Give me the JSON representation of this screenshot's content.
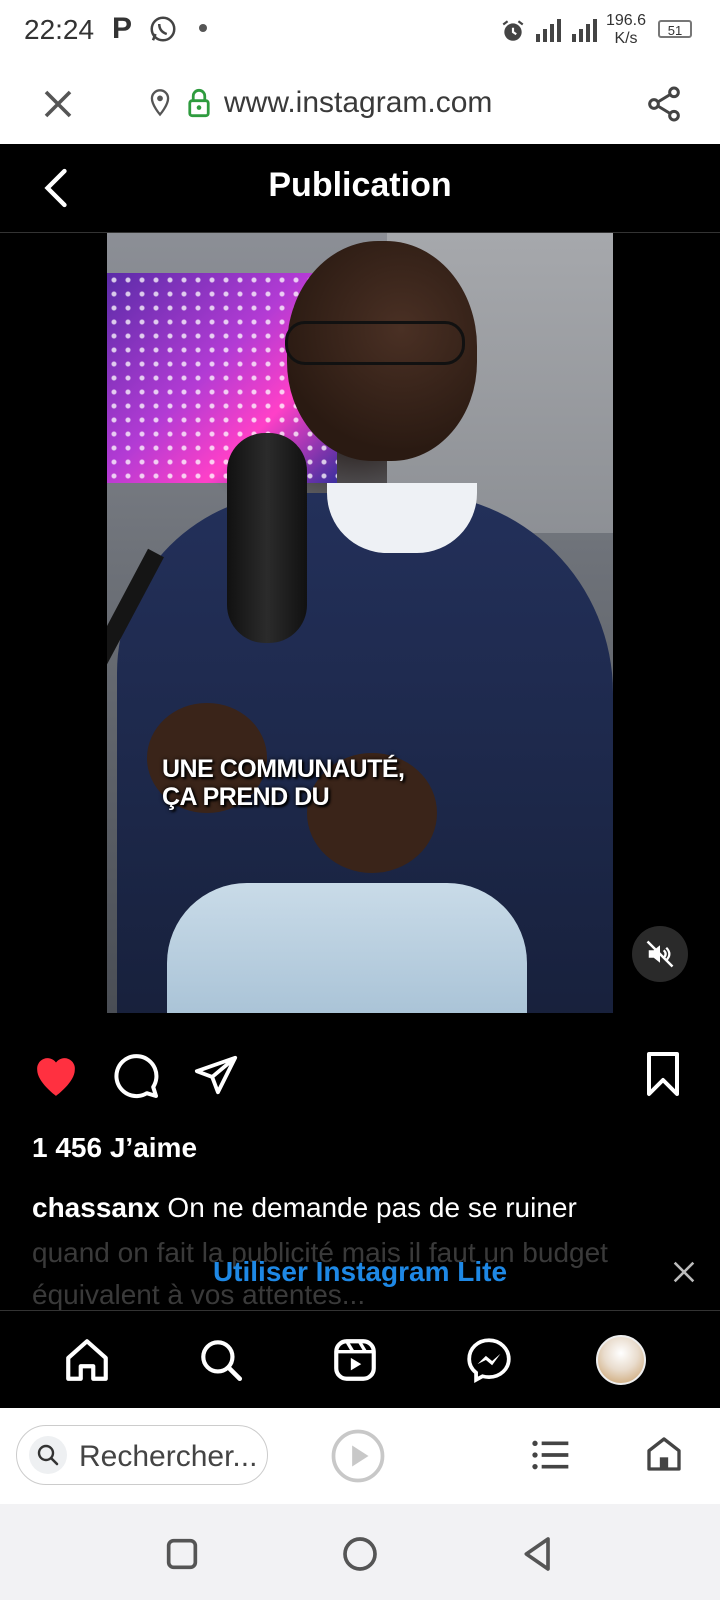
{
  "status_bar": {
    "time": "22:24",
    "p_icon": "P",
    "speed_value": "196.6",
    "speed_unit": "K/s",
    "battery": "51",
    "icons": [
      "whatsapp-icon",
      "alarm-icon",
      "signal-icon",
      "battery-icon"
    ]
  },
  "browser": {
    "url": "www.instagram.com",
    "search_placeholder": "Rechercher..."
  },
  "post": {
    "header_title": "Publication",
    "video_caption": "UNE COMMUNAUTÉ,\nÇA PREND DU",
    "likes": "1 456 J’aime",
    "username": "chassanx",
    "caption": " On ne demande pas de se ruiner",
    "caption_faded": "quand on fait la publicité mais il faut un budget équivalent à vos attentes..."
  },
  "banner": {
    "label": "Utiliser Instagram Lite"
  },
  "colors": {
    "like_red": "#ff3040",
    "link_blue": "#1e88e5",
    "ig_bg": "#000000"
  }
}
